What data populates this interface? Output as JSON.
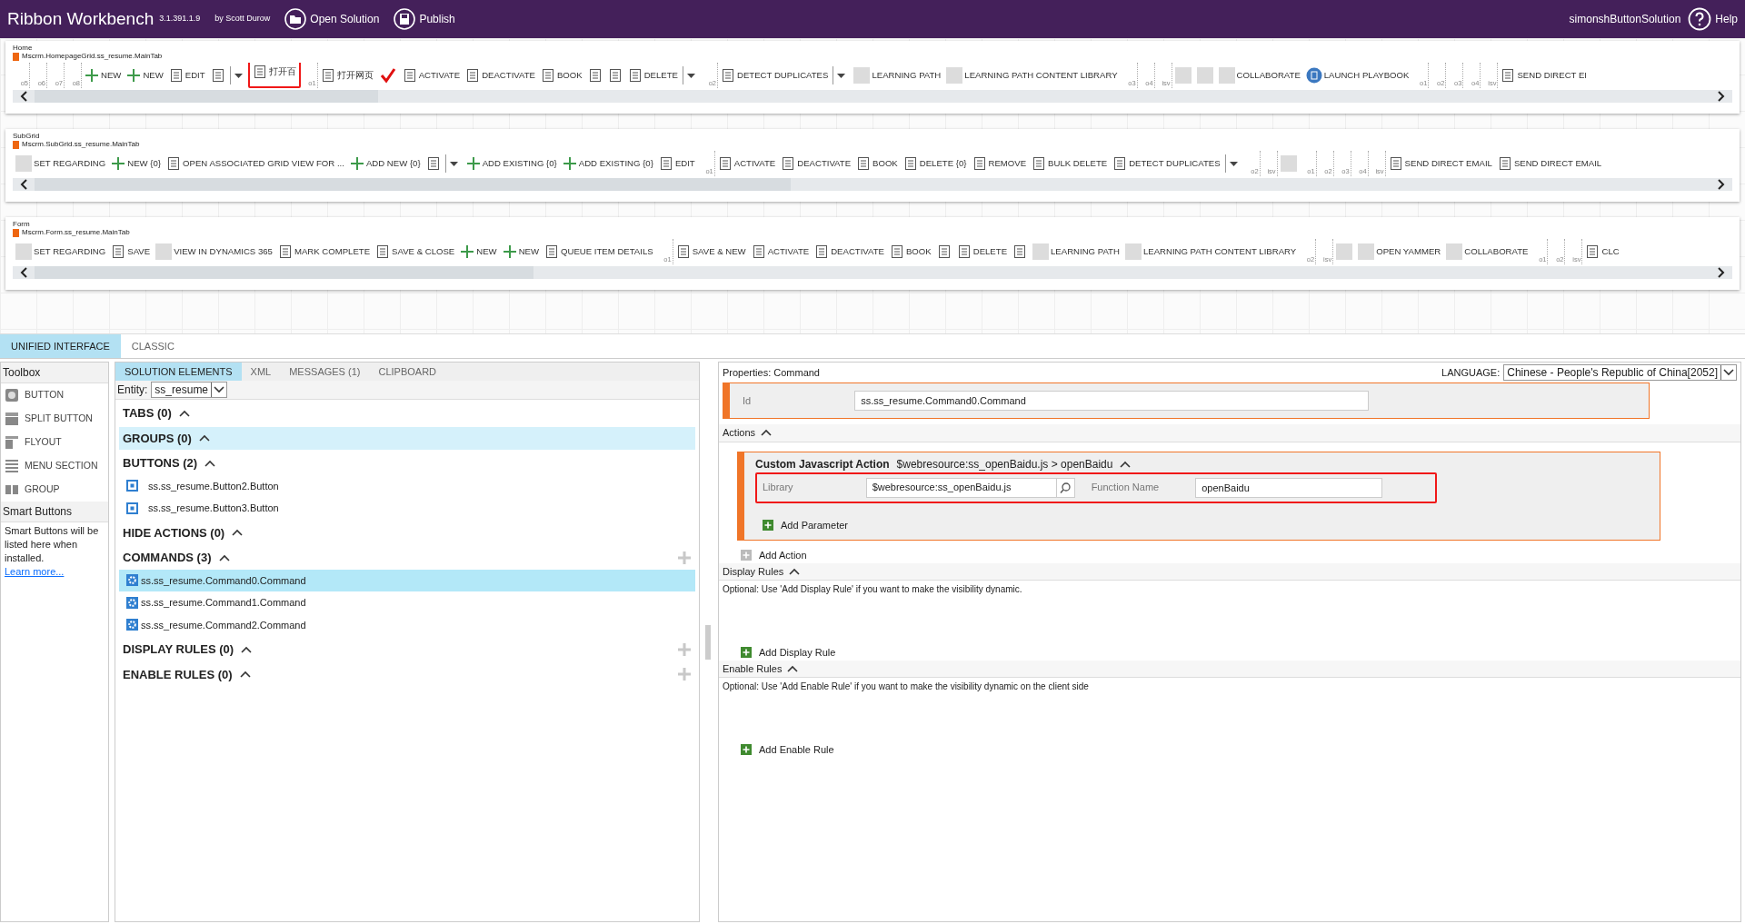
{
  "header": {
    "title": "Ribbon Workbench",
    "version": "3.1.391.1.9",
    "author": "by Scott Durow",
    "actions": [
      "Open Solution",
      "Publish"
    ],
    "solution": "simonshButtonSolution",
    "help": "Help"
  },
  "ribbons": [
    {
      "name": "Home",
      "tab_id": "Mscrm.HomepageGrid.ss_resume.MainTab",
      "items": [
        {
          "kind": "slot",
          "label": "o5"
        },
        {
          "kind": "slot",
          "label": "o6"
        },
        {
          "kind": "slot",
          "label": "o7"
        },
        {
          "kind": "slot",
          "label": "o8"
        },
        {
          "kind": "add",
          "label": "NEW"
        },
        {
          "kind": "add",
          "label": "NEW"
        },
        {
          "kind": "glyph",
          "label": "EDIT"
        },
        {
          "kind": "glyph"
        },
        {
          "kind": "split"
        },
        {
          "kind": "glyph",
          "label": "打开百",
          "highlighted": true
        },
        {
          "kind": "slot",
          "label": "o1"
        },
        {
          "kind": "glyph",
          "label": "打开网页"
        },
        {
          "kind": "check"
        },
        {
          "kind": "glyph",
          "label": "ACTIVATE"
        },
        {
          "kind": "glyph",
          "label": "DEACTIVATE"
        },
        {
          "kind": "glyph",
          "label": "BOOK"
        },
        {
          "kind": "glyph"
        },
        {
          "kind": "glyph"
        },
        {
          "kind": "glyph",
          "label": "DELETE"
        },
        {
          "kind": "split"
        },
        {
          "kind": "slot",
          "label": "o2"
        },
        {
          "kind": "glyph",
          "label": "DETECT DUPLICATES"
        },
        {
          "kind": "split"
        },
        {
          "kind": "blank",
          "label": "LEARNING PATH"
        },
        {
          "kind": "blank",
          "label": "LEARNING PATH CONTENT LIBRARY"
        },
        {
          "kind": "slot",
          "label": "o3"
        },
        {
          "kind": "slot",
          "label": "o4"
        },
        {
          "kind": "slot",
          "label": "isv"
        },
        {
          "kind": "blank"
        },
        {
          "kind": "blank"
        },
        {
          "kind": "blank",
          "label": "COLLABORATE"
        },
        {
          "kind": "circle",
          "label": "LAUNCH PLAYBOOK"
        },
        {
          "kind": "slot",
          "label": "o1"
        },
        {
          "kind": "slot",
          "label": "o2"
        },
        {
          "kind": "slot",
          "label": "o3"
        },
        {
          "kind": "slot",
          "label": "o4"
        },
        {
          "kind": "slot",
          "label": "isv"
        },
        {
          "kind": "glyph",
          "label": "SEND DIRECT EI"
        }
      ]
    },
    {
      "name": "SubGrid",
      "tab_id": "Mscrm.SubGrid.ss_resume.MainTab",
      "items": [
        {
          "kind": "blank",
          "label": "SET REGARDING"
        },
        {
          "kind": "add",
          "label": "NEW {0}"
        },
        {
          "kind": "glyph",
          "label": "OPEN ASSOCIATED GRID VIEW FOR ..."
        },
        {
          "kind": "add",
          "label": "ADD NEW {0}"
        },
        {
          "kind": "glyph"
        },
        {
          "kind": "split"
        },
        {
          "kind": "add",
          "label": "ADD EXISTING {0}"
        },
        {
          "kind": "add",
          "label": "ADD EXISTING {0}"
        },
        {
          "kind": "glyph",
          "label": "EDIT"
        },
        {
          "kind": "slot",
          "label": "o1"
        },
        {
          "kind": "glyph",
          "label": "ACTIVATE"
        },
        {
          "kind": "glyph",
          "label": "DEACTIVATE"
        },
        {
          "kind": "glyph",
          "label": "BOOK"
        },
        {
          "kind": "glyph",
          "label": "DELETE {0}"
        },
        {
          "kind": "glyph",
          "label": "REMOVE"
        },
        {
          "kind": "glyph",
          "label": "BULK DELETE"
        },
        {
          "kind": "glyph",
          "label": "DETECT DUPLICATES"
        },
        {
          "kind": "split"
        },
        {
          "kind": "slot",
          "label": "o2"
        },
        {
          "kind": "slot",
          "label": "isv"
        },
        {
          "kind": "blank"
        },
        {
          "kind": "slot",
          "label": "o1"
        },
        {
          "kind": "slot",
          "label": "o2"
        },
        {
          "kind": "slot",
          "label": "o3"
        },
        {
          "kind": "slot",
          "label": "o4"
        },
        {
          "kind": "slot",
          "label": "isv"
        },
        {
          "kind": "glyph",
          "label": "SEND DIRECT EMAIL"
        },
        {
          "kind": "glyph",
          "label": "SEND DIRECT EMAIL"
        }
      ]
    },
    {
      "name": "Form",
      "tab_id": "Mscrm.Form.ss_resume.MainTab",
      "items": [
        {
          "kind": "blank",
          "label": "SET REGARDING"
        },
        {
          "kind": "glyph",
          "label": "SAVE"
        },
        {
          "kind": "blank",
          "label": "VIEW IN DYNAMICS 365"
        },
        {
          "kind": "glyph",
          "label": "MARK COMPLETE"
        },
        {
          "kind": "glyph",
          "label": "SAVE & CLOSE"
        },
        {
          "kind": "add",
          "label": "NEW"
        },
        {
          "kind": "add",
          "label": "NEW"
        },
        {
          "kind": "glyph",
          "label": "QUEUE ITEM DETAILS"
        },
        {
          "kind": "slot",
          "label": "o1"
        },
        {
          "kind": "glyph",
          "label": "SAVE & NEW"
        },
        {
          "kind": "glyph",
          "label": "ACTIVATE"
        },
        {
          "kind": "glyph",
          "label": "DEACTIVATE"
        },
        {
          "kind": "glyph",
          "label": "BOOK"
        },
        {
          "kind": "glyph"
        },
        {
          "kind": "glyph",
          "label": "DELETE"
        },
        {
          "kind": "glyph"
        },
        {
          "kind": "blank",
          "label": "LEARNING PATH"
        },
        {
          "kind": "blank",
          "label": "LEARNING PATH CONTENT LIBRARY"
        },
        {
          "kind": "slot",
          "label": "o2"
        },
        {
          "kind": "slot",
          "label": "isv"
        },
        {
          "kind": "blank"
        },
        {
          "kind": "blank",
          "label": "OPEN YAMMER"
        },
        {
          "kind": "blank",
          "label": "COLLABORATE"
        },
        {
          "kind": "slot",
          "label": "o1"
        },
        {
          "kind": "slot",
          "label": "o2"
        },
        {
          "kind": "slot",
          "label": "isv"
        },
        {
          "kind": "glyph",
          "label": "CLC"
        }
      ]
    }
  ],
  "mode_tabs": [
    {
      "label": "UNIFIED INTERFACE",
      "selected": true
    },
    {
      "label": "CLASSIC",
      "selected": false
    }
  ],
  "toolbox": {
    "title": "Toolbox",
    "items": [
      "BUTTON",
      "SPLIT BUTTON",
      "FLYOUT",
      "MENU SECTION",
      "GROUP"
    ],
    "smart_title": "Smart Buttons",
    "smart_text": "Smart Buttons will be listed here when installed.",
    "smart_link": "Learn more..."
  },
  "elements": {
    "tabs": [
      {
        "label": "SOLUTION ELEMENTS",
        "selected": true
      },
      {
        "label": "XML",
        "selected": false
      },
      {
        "label": "MESSAGES (1)",
        "selected": false
      },
      {
        "label": "CLIPBOARD",
        "selected": false
      }
    ],
    "entity_label": "Entity:",
    "entity": "ss_resume",
    "sections": [
      {
        "title": "TABS (0)",
        "expanded": true,
        "selected": false,
        "addable": false
      },
      {
        "title": "GROUPS (0)",
        "expanded": true,
        "selected": true,
        "addable": false
      },
      {
        "title": "BUTTONS (2)",
        "expanded": true,
        "selected": false,
        "addable": false,
        "items": [
          {
            "kind": "button",
            "label": "ss.ss_resume.Button2.Button",
            "selected": false
          },
          {
            "kind": "button",
            "label": "ss.ss_resume.Button3.Button",
            "selected": false
          }
        ]
      },
      {
        "title": "HIDE ACTIONS (0)",
        "expanded": true,
        "selected": false,
        "addable": false
      },
      {
        "title": "COMMANDS (3)",
        "expanded": true,
        "selected": false,
        "addable": true,
        "items": [
          {
            "kind": "command",
            "label": "ss.ss_resume.Command0.Command",
            "selected": true
          },
          {
            "kind": "command",
            "label": "ss.ss_resume.Command1.Command",
            "selected": false
          },
          {
            "kind": "command",
            "label": "ss.ss_resume.Command2.Command",
            "selected": false
          }
        ]
      },
      {
        "title": "DISPLAY RULES (0)",
        "expanded": true,
        "selected": false,
        "addable": true
      },
      {
        "title": "ENABLE RULES (0)",
        "expanded": true,
        "selected": false,
        "addable": true
      }
    ]
  },
  "properties": {
    "title": "Properties: Command",
    "language_label": "LANGUAGE:",
    "language": "Chinese - People's Republic of China[2052]",
    "id_label": "Id",
    "id": "ss.ss_resume.Command0.Command",
    "actions": {
      "title": "Actions",
      "expanded": true,
      "items": [
        {
          "title": "Custom Javascript Action",
          "summary": "$webresource:ss_openBaidu.js > openBaidu",
          "expanded": true,
          "library_label": "Library",
          "library": "$webresource:ss_openBaidu.js",
          "function_label": "Function Name",
          "function": "openBaidu",
          "highlighted": true,
          "add_parameter": "Add Parameter"
        }
      ],
      "add": "Add Action"
    },
    "rules": [
      {
        "title": "Display Rules",
        "expanded": true,
        "note": "Optional: Use 'Add Display Rule' if you want to make the visibility dynamic.",
        "add": "Add Display Rule"
      },
      {
        "title": "Enable Rules",
        "expanded": true,
        "note": "Optional: Use 'Add Enable Rule' if you want to make the visibility dynamic on the client side",
        "add": "Add Enable Rule"
      }
    ]
  }
}
